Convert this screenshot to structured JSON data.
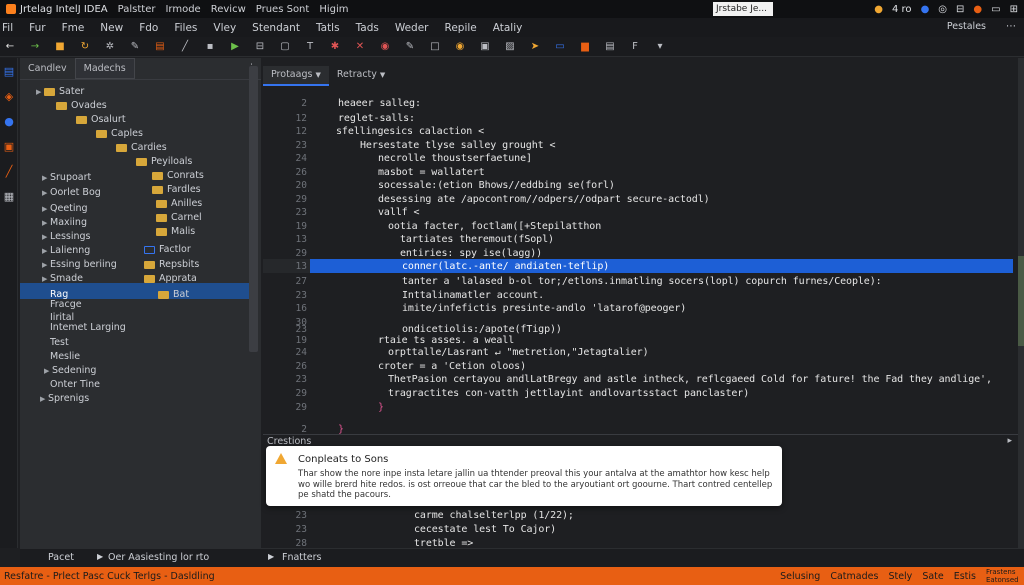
{
  "titlebar": {
    "app_title": "Jrtelag IntelJ IDEA",
    "menu": [
      "Palstter",
      "Irmode",
      "Revicw",
      "Prues Sont",
      "Higim"
    ],
    "search_value": "Jrstabe Je...",
    "right_text": "4 ro"
  },
  "menubar": {
    "items": [
      "Fil",
      "Fur",
      "Fme",
      "New",
      "Fdo",
      "Files",
      "Vley",
      "Stendant",
      "Tatls",
      "Tads",
      "Weder",
      "Repile",
      "Ataliy"
    ],
    "right_label": "Pestales"
  },
  "toolbar": {
    "icons": [
      "back-arrow-icon",
      "forward-arrow-icon",
      "blocks-icon",
      "refresh-icon",
      "gear-icon",
      "wrench-icon",
      "file-icon",
      "pen-icon",
      "save-icon",
      "run-icon",
      "split-icon",
      "box-icon",
      "text-icon",
      "debug-icon",
      "close-icon",
      "stop-icon",
      "edit-icon",
      "square-icon",
      "coin-icon",
      "panel-icon",
      "image-icon",
      "send-icon",
      "monitor-icon",
      "folder-icon",
      "build-icon",
      "filter-icon",
      "dropdown-icon"
    ]
  },
  "project_panel": {
    "tabs": [
      "Candlev",
      "Madechs"
    ],
    "rows": [
      {
        "label": "Sater",
        "indent": 1
      },
      {
        "label": "Ovades",
        "indent": 2
      },
      {
        "label": "Osalurt",
        "indent": 3
      },
      {
        "label": "Caples",
        "indent": 4
      },
      {
        "label": "Cardies",
        "indent": 5
      },
      {
        "label": "Peyiloals",
        "indent": 6
      },
      {
        "label": "Srupoart",
        "indent": 1
      },
      {
        "label": "Conrats",
        "indent": 6
      },
      {
        "label": "Oorlet Bog",
        "indent": 1
      },
      {
        "label": "Fardles",
        "indent": 6
      },
      {
        "label": "Qeeting",
        "indent": 1
      },
      {
        "label": "Anilles",
        "indent": 7
      },
      {
        "label": "Maxiing",
        "indent": 1
      },
      {
        "label": "Carnel",
        "indent": 7
      },
      {
        "label": "Lessings",
        "indent": 1
      },
      {
        "label": "Malis",
        "indent": 7
      },
      {
        "label": "Lalienng",
        "indent": 1
      },
      {
        "label": "Factlor",
        "indent": 6
      },
      {
        "label": "Essing beriing",
        "indent": 1
      },
      {
        "label": "Repsbits",
        "indent": 6
      },
      {
        "label": "Smade",
        "indent": 1
      },
      {
        "label": "Apprata",
        "indent": 6
      },
      {
        "label": "Rag",
        "indent": 2
      },
      {
        "label": "Bat",
        "indent": 6
      },
      {
        "label": "Fracge",
        "indent": 2
      },
      {
        "label": "Iirital",
        "indent": 2
      },
      {
        "label": "Intemet Larging",
        "indent": 2
      },
      {
        "label": "Test",
        "indent": 2
      },
      {
        "label": "Meslie",
        "indent": 2
      },
      {
        "label": "Sedening",
        "indent": 1
      },
      {
        "label": "Onter Tine",
        "indent": 2
      },
      {
        "label": "Sprenigs",
        "indent": 1
      }
    ]
  },
  "editor": {
    "tabs": [
      "Protaags",
      "Retracty"
    ],
    "lines": [
      {
        "n": "2",
        "code": "heaeer salleg:"
      },
      {
        "n": "12",
        "code": "reglet-salls:"
      },
      {
        "n": "12",
        "code": "sfellingesics calaction <"
      },
      {
        "n": "23",
        "code": "Hersestate tlyse salley grought <"
      },
      {
        "n": "24",
        "code": "necrolle thoustserfaetune]"
      },
      {
        "n": "26",
        "code": "masbot = wallatert"
      },
      {
        "n": "20",
        "code": "socessale:(etion Bhows//eddbing se(forl)"
      },
      {
        "n": "29",
        "code": "desessing ate /apocontrom//odpers//odpart secure-actodl)"
      },
      {
        "n": "23",
        "code": "vallf <"
      },
      {
        "n": "19",
        "code": "ootia facter, foctlam([+Stepilatthon"
      },
      {
        "n": "13",
        "code": "tartiates theremout(fSopl)"
      },
      {
        "n": "29",
        "code": "entiries: spy ise(lagg))"
      },
      {
        "n": "13",
        "code": "conner(latc.-ante/ andiaten-teflip)"
      },
      {
        "n": "27",
        "code": "tanter a 'lalased b-ol tor;/etlons.inmatling socers(lopl) copurch furnes/Ceople):"
      },
      {
        "n": "23",
        "code": "Inttalinamatler account."
      },
      {
        "n": "16",
        "code": "imite/infefictis presinte-andlo 'latarof@peoger)"
      },
      {
        "n": "30",
        "code": ""
      },
      {
        "n": "23",
        "code": "ondicetiolis:/apote(fTigp))"
      },
      {
        "n": "19",
        "code": "rtaie ts asses. a weall"
      },
      {
        "n": "24",
        "code": "orpttalle/Lasrant ↵ \"metretion,\"Jetagtalier)"
      },
      {
        "n": "26",
        "code": "croter = a 'Cetion oloos)"
      },
      {
        "n": "23",
        "code": "TheτPasion certayou andlLatBregy and astle intheck, reflcgaeed Cold for fature! the Fad they andlige',"
      },
      {
        "n": "29",
        "code": "tragractites con-vatth jettlayint andlovartsstact panclaster)"
      },
      {
        "n": "29",
        "code": "}"
      },
      {
        "n": "2",
        "code": "}"
      }
    ]
  },
  "bottom_tool": {
    "title": "Crestions",
    "lines": [
      {
        "n": "23",
        "code": "carme chalselterlpp (1/22);"
      },
      {
        "n": "23",
        "code": "cecestate lest To Cajor)"
      },
      {
        "n": "28",
        "code": "tretble =>"
      }
    ]
  },
  "notification": {
    "title": "Conpleats to Sons",
    "message": "Thar show the nore inpe insta letare jallin ua thtender preoval this your antalva at the amathtor how kesc help wo wille brerd hite redos. is ost orreoue that car the bled to the aryoutiant ort goourne. Thart contred centellep pe shatd the pacours."
  },
  "bottom_tabs": {
    "left": "Pacet",
    "middle": "Oer Aasiesting lor rto",
    "right": "Fnatters"
  },
  "status": {
    "left": "Resfatre - Prlect Pasc Cuck Terlgs - Dasldling",
    "right_items": [
      "Selusing",
      "Catmades",
      "Stely",
      "Sate",
      "Estis",
      "Frastens Eatonsed"
    ]
  },
  "colors": {
    "accent": "#3574f0",
    "status_bar": "#e85f13",
    "folder": "#d7a73a",
    "selection": "#1f4e8f",
    "highlight_line": "#1d5fd6"
  }
}
